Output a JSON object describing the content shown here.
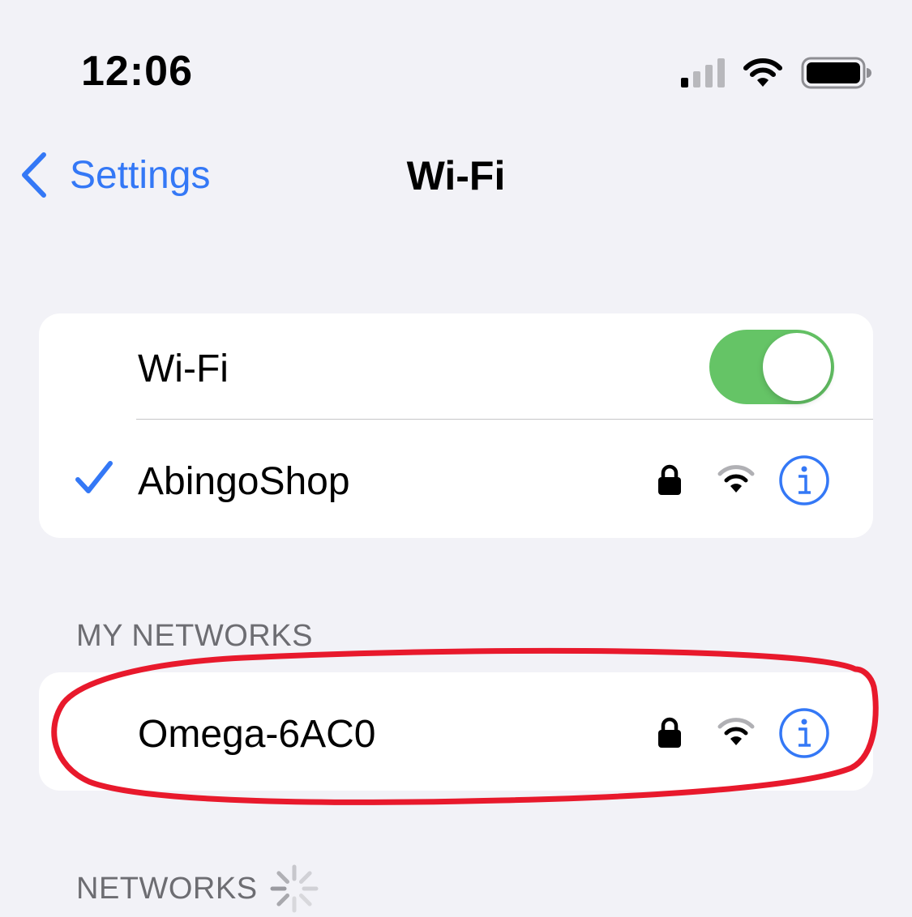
{
  "status_bar": {
    "time": "12:06",
    "icons": [
      "cellular-signal-icon",
      "wifi-icon",
      "battery-icon"
    ]
  },
  "nav": {
    "back_label": "Settings",
    "title": "Wi-Fi"
  },
  "wifi_card": {
    "toggle_label": "Wi-Fi",
    "toggle_on": true,
    "connected_network": {
      "name": "AbingoShop",
      "connected": true,
      "secured": true
    }
  },
  "my_networks": {
    "header": "MY NETWORKS",
    "items": [
      {
        "name": "Omega-6AC0",
        "secured": true
      }
    ]
  },
  "networks": {
    "header": "NETWORKS",
    "loading": true
  },
  "colors": {
    "accent": "#3478f6",
    "toggle_on": "#65c466",
    "annotation": "#e8192c",
    "background": "#f2f2f7"
  }
}
